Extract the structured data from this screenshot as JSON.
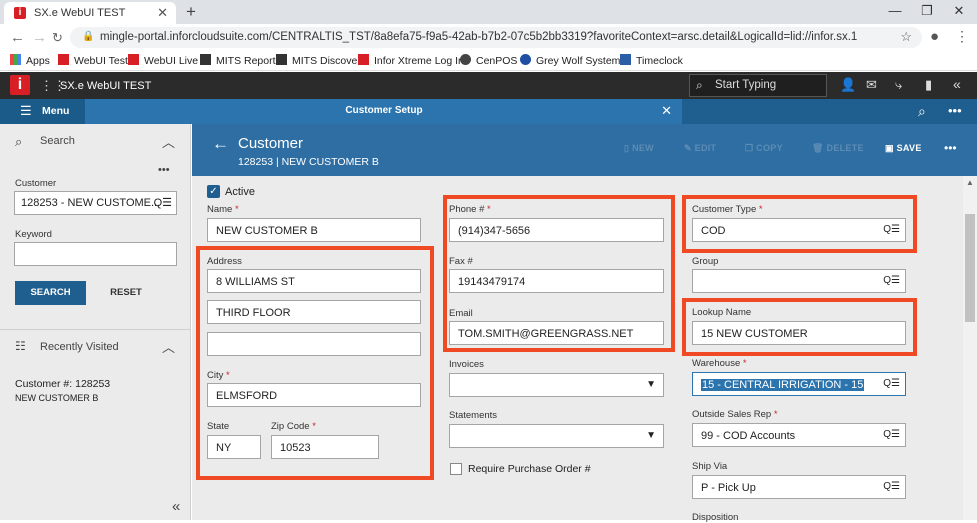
{
  "browser": {
    "tab_title": "SX.e WebUI TEST",
    "url": "mingle-portal.inforcloudsuite.com/CENTRALTIS_TST/8a8efa75-f9a5-42ab-b7b2-07c5b2bb3319?favoriteContext=arsc.detail&LogicalId=lid://infor.sx.1",
    "bookmarks": [
      "Apps",
      "WebUI Test",
      "WebUI Live",
      "MITS Report",
      "MITS Discover",
      "Infor Xtreme Log In",
      "CenPOS",
      "Grey Wolf Systems",
      "Timeclock"
    ]
  },
  "appbar": {
    "title": "SX.e WebUI TEST",
    "search_placeholder": "Start Typing"
  },
  "modbar": {
    "menu_label": "Menu",
    "module_title": "Customer Setup"
  },
  "left": {
    "search_label": "Search",
    "customer_label": "Customer",
    "customer_value": "128253 - NEW CUSTOME...",
    "keyword_label": "Keyword",
    "keyword_value": "",
    "search_button": "SEARCH",
    "reset_button": "RESET",
    "recent_label": "Recently Visited",
    "recent_line1": "Customer #:  128253",
    "recent_line2": "NEW CUSTOMER B"
  },
  "header": {
    "title": "Customer",
    "subtitle": "128253 | NEW CUSTOMER B",
    "new": "NEW",
    "edit": "EDIT",
    "copy": "COPY",
    "delete": "DELETE",
    "save": "SAVE"
  },
  "form": {
    "active_label": "Active",
    "active_checked": true,
    "name_label": "Name",
    "name_value": "NEW CUSTOMER B",
    "address_label": "Address",
    "address1": "8 WILLIAMS ST",
    "address2": "THIRD FLOOR",
    "address3": "",
    "city_label": "City",
    "city_value": "ELMSFORD",
    "state_label": "State",
    "state_value": "NY",
    "zip_label": "Zip Code",
    "zip_value": "10523",
    "phone_label": "Phone #",
    "phone_value": "(914)347-5656",
    "fax_label": "Fax #",
    "fax_value": "19143479174",
    "email_label": "Email",
    "email_value": "TOM.SMITH@GREENGRASS.NET",
    "invoices_label": "Invoices",
    "invoices_value": "",
    "statements_label": "Statements",
    "statements_value": "",
    "po_label": "Require Purchase Order #",
    "customer_type_label": "Customer Type",
    "customer_type_value": "COD",
    "group_label": "Group",
    "group_value": "",
    "lookup_label": "Lookup Name",
    "lookup_value": "15 NEW CUSTOMER",
    "warehouse_label": "Warehouse",
    "warehouse_value": "15 - CENTRAL IRRIGATION - 15",
    "outside_rep_label": "Outside Sales Rep",
    "outside_rep_value": "99 - COD Accounts",
    "ship_via_label": "Ship Via",
    "ship_via_value": "P - Pick Up",
    "disposition_label": "Disposition"
  },
  "colors": {
    "accent_red": "#f04a24",
    "header_blue": "#2f6ea3",
    "infor_red": "#d91f26"
  }
}
